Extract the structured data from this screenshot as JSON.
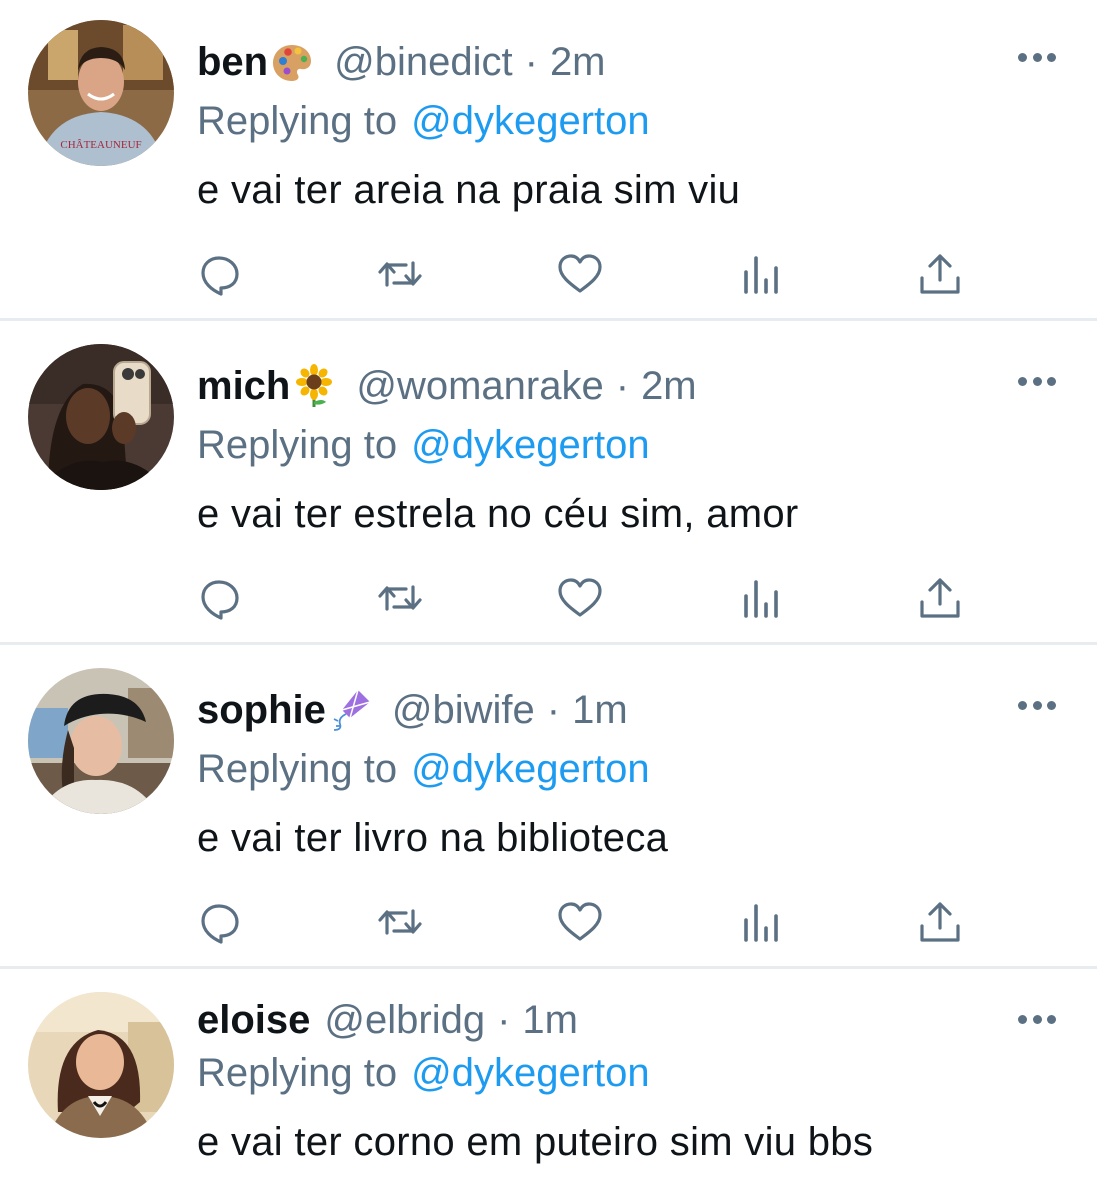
{
  "replies": [
    {
      "name": "ben",
      "name_emoji": "palette-emoji",
      "handle": "@binedict",
      "separator": "·",
      "time": "2m",
      "replying_prefix": "Replying to",
      "replying_to": "@dykegerton",
      "text": "e vai ter areia na praia sim viu"
    },
    {
      "name": "mich",
      "name_emoji": "sunflower-emoji",
      "handle": "@womanrake",
      "separator": "·",
      "time": "2m",
      "replying_prefix": "Replying to",
      "replying_to": "@dykegerton",
      "text": "e vai ter estrela no céu sim, amor"
    },
    {
      "name": "sophie",
      "name_emoji": "kite-emoji",
      "handle": "@biwife",
      "separator": "·",
      "time": "1m",
      "replying_prefix": "Replying to",
      "replying_to": "@dykegerton",
      "text": "e vai ter livro na biblioteca"
    },
    {
      "name": "eloise",
      "name_emoji": "",
      "handle": "@elbridg",
      "separator": "·",
      "time": "1m",
      "replying_prefix": "Replying to",
      "replying_to": "@dykegerton",
      "text": "e vai ter corno em puteiro sim viu bbs"
    }
  ],
  "icons": {
    "reply": "reply-icon",
    "retweet": "retweet-icon",
    "like": "heart-icon",
    "analytics": "analytics-icon",
    "share": "share-icon",
    "more": "more-icon"
  },
  "colors": {
    "text": "#0f1419",
    "secondary": "#5b7083",
    "accent": "#1d9bf0",
    "divider": "#e6ecf0"
  }
}
